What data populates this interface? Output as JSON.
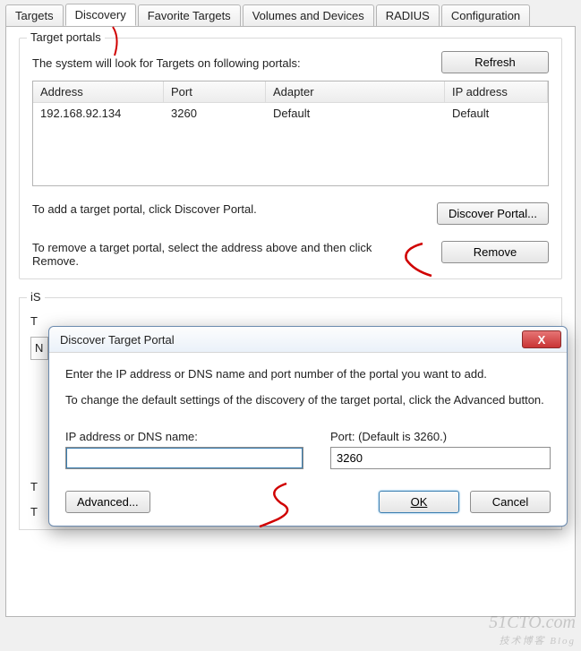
{
  "tabs": {
    "targets": "Targets",
    "discovery": "Discovery",
    "favorite": "Favorite Targets",
    "volumes": "Volumes and Devices",
    "radius": "RADIUS",
    "configuration": "Configuration"
  },
  "group": {
    "title": "Target portals",
    "look_text": "The system will look for Targets on following portals:",
    "refresh": "Refresh",
    "columns": {
      "address": "Address",
      "port": "Port",
      "adapter": "Adapter",
      "ip": "IP address"
    },
    "rows": [
      {
        "address": "192.168.92.134",
        "port": "3260",
        "adapter": "Default",
        "ip": "Default"
      }
    ],
    "add_text": "To add a target portal, click Discover Portal.",
    "discover_btn": "Discover Portal...",
    "remove_text": "To remove a target portal, select the address above and then click Remove.",
    "remove_btn": "Remove"
  },
  "iscsi_prefix": "iS",
  "peek_T": "T",
  "peek_N": "N",
  "dialog": {
    "title": "Discover Target Portal",
    "line1": "Enter the IP address or DNS name and port number of the portal you want to add.",
    "line2": "To change the default settings of the discovery of the target portal, click the Advanced button.",
    "ip_label": "IP address or DNS name:",
    "port_label": "Port: (Default is 3260.)",
    "ip_value": "",
    "port_value": "3260",
    "advanced": "Advanced...",
    "ok": "OK",
    "cancel": "Cancel"
  },
  "close_x": "X",
  "watermark": "51CTO.com",
  "watermark_sub": "技术博客  Blog"
}
